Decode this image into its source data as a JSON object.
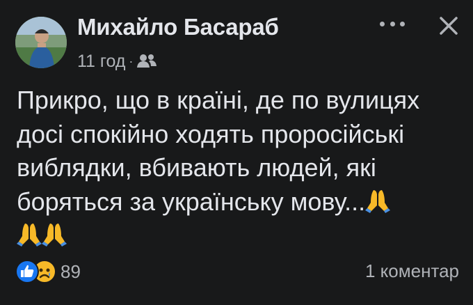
{
  "post": {
    "author": "Михайло Басараб",
    "time": "11 год",
    "separator": "·",
    "privacy_icon": "friends-icon",
    "text": "Прикро, що в країні, де по вулицях досі спокійно ходять проросійські виблядки, вбивають людей, які боряться за українську мову...",
    "emoji": "folded-hands-icon"
  },
  "header": {
    "more_icon": "more-icon",
    "close_icon": "close-icon"
  },
  "footer": {
    "reaction_icons": [
      "like-icon",
      "sad-icon"
    ],
    "reaction_count": "89",
    "comments": "1 коментар"
  },
  "colors": {
    "background": "#18191a",
    "text": "#e4e6eb",
    "secondary_text": "#b0b3b8",
    "like_blue": "#1877f2",
    "emoji_yellow": "#f7b928"
  }
}
